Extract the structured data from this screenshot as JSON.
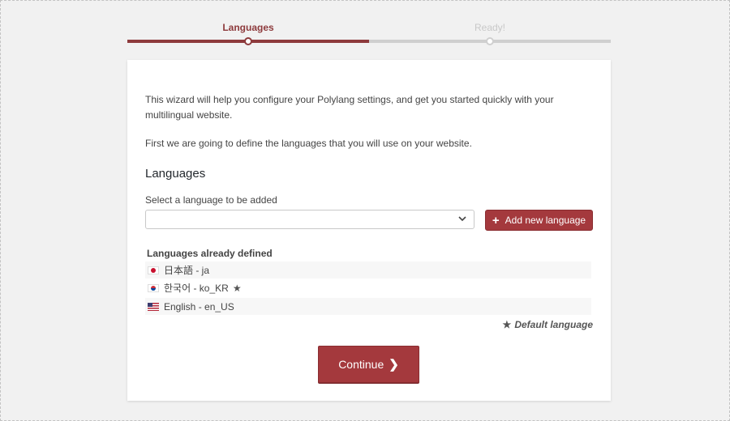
{
  "steps": [
    {
      "label": "Languages",
      "state": "active"
    },
    {
      "label": "Ready!",
      "state": "inactive"
    }
  ],
  "colors": {
    "accent": "#a4393d",
    "step_active": "#8d3a3c",
    "step_inactive": "#cfcfcf"
  },
  "intro": {
    "line1": "This wizard will help you configure your Polylang settings, and get you started quickly with your multilingual website.",
    "line2": "First we are going to define the languages that you will use on your website."
  },
  "languages_section": {
    "heading": "Languages",
    "select_label": "Select a language to be added",
    "select_value": "",
    "add_button_label": "Add new language",
    "defined_title": "Languages already defined",
    "defined": [
      {
        "flag": "jp-flag-icon",
        "label": "日本語 - ja",
        "default": false
      },
      {
        "flag": "kr-flag-icon",
        "label": "한국어 - ko_KR",
        "default": true
      },
      {
        "flag": "us-flag-icon",
        "label": "English - en_US",
        "default": false
      }
    ],
    "default_note": "Default language"
  },
  "footer": {
    "continue_label": "Continue"
  }
}
